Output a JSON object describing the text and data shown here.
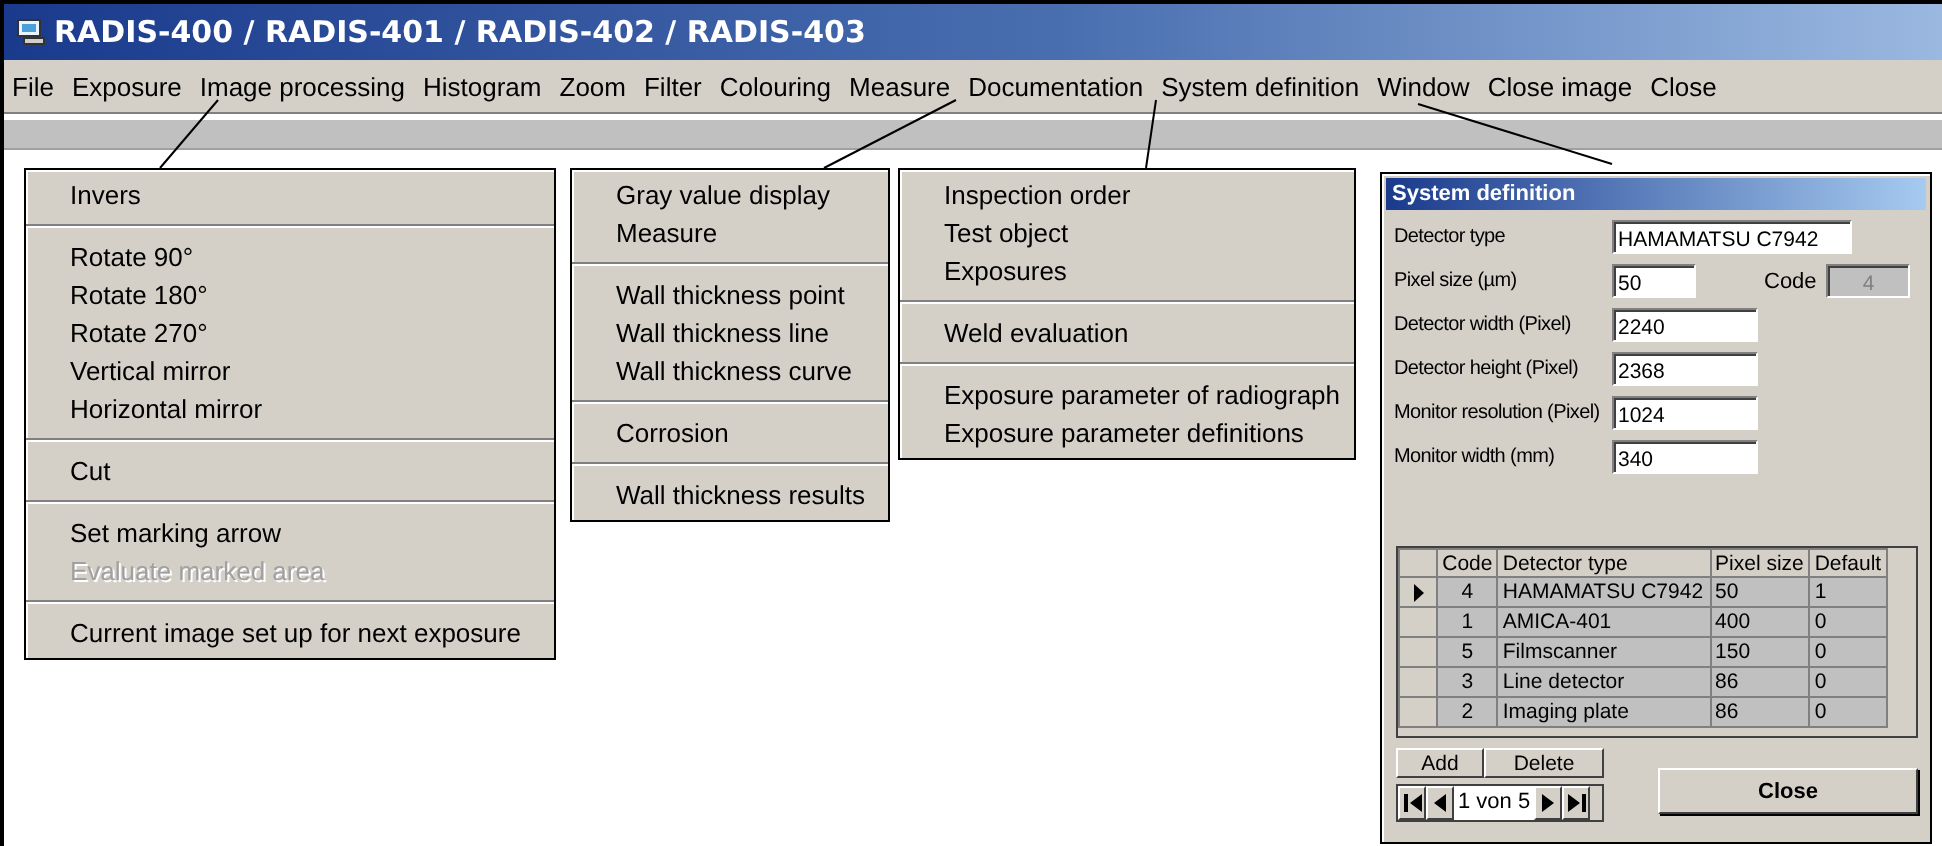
{
  "window": {
    "title": "RADIS-400 / RADIS-401 / RADIS-402 / RADIS-403"
  },
  "menu_bar": [
    "File",
    "Exposure",
    "Image processing",
    "Histogram",
    "Zoom",
    "Filter",
    "Colouring",
    "Measure",
    "Documentation",
    "System definition",
    "Window",
    "Close image",
    "Close"
  ],
  "menus": [
    {
      "items": [
        {
          "kind": "item",
          "label": "Invers",
          "disabled": false
        },
        {
          "kind": "separator"
        },
        {
          "kind": "item",
          "label": "Rotate 90°",
          "disabled": false
        },
        {
          "kind": "item",
          "label": "Rotate 180°",
          "disabled": false
        },
        {
          "kind": "item",
          "label": "Rotate 270°",
          "disabled": false
        },
        {
          "kind": "item",
          "label": "Vertical mirror",
          "disabled": false
        },
        {
          "kind": "item",
          "label": "Horizontal mirror",
          "disabled": false
        },
        {
          "kind": "separator"
        },
        {
          "kind": "item",
          "label": "Cut",
          "disabled": false
        },
        {
          "kind": "separator"
        },
        {
          "kind": "item",
          "label": "Set marking arrow",
          "disabled": false
        },
        {
          "kind": "item",
          "label": "Evaluate marked area",
          "disabled": true
        },
        {
          "kind": "separator"
        },
        {
          "kind": "item",
          "label": "Current image set up for next exposure",
          "disabled": false
        }
      ]
    },
    {
      "items": [
        {
          "kind": "item",
          "label": "Gray value display",
          "disabled": false
        },
        {
          "kind": "item",
          "label": "Measure",
          "disabled": false
        },
        {
          "kind": "separator"
        },
        {
          "kind": "item",
          "label": "Wall thickness point",
          "disabled": false
        },
        {
          "kind": "item",
          "label": "Wall thickness line",
          "disabled": false
        },
        {
          "kind": "item",
          "label": "Wall thickness curve",
          "disabled": false
        },
        {
          "kind": "separator"
        },
        {
          "kind": "item",
          "label": "Corrosion",
          "disabled": false
        },
        {
          "kind": "separator"
        },
        {
          "kind": "item",
          "label": "Wall thickness results",
          "disabled": false
        }
      ]
    },
    {
      "items": [
        {
          "kind": "item",
          "label": "Inspection order",
          "disabled": false
        },
        {
          "kind": "item",
          "label": "Test object",
          "disabled": false
        },
        {
          "kind": "item",
          "label": "Exposures",
          "disabled": false
        },
        {
          "kind": "separator"
        },
        {
          "kind": "item",
          "label": "Weld evaluation",
          "disabled": false
        },
        {
          "kind": "separator"
        },
        {
          "kind": "item",
          "label": "Exposure parameter of radiograph",
          "disabled": false
        },
        {
          "kind": "item",
          "label": "Exposure parameter definitions",
          "disabled": false
        }
      ]
    }
  ],
  "dialog": {
    "title": "System definition",
    "fields": [
      {
        "label": "Detector type",
        "value": "HAMAMATSU C7942"
      },
      {
        "label": "Pixel size (µm)",
        "value": "50",
        "code_label": "Code",
        "code_value": "4"
      },
      {
        "label": "Detector width (Pixel)",
        "value": "2240"
      },
      {
        "label": "Detector height (Pixel)",
        "value": "2368"
      },
      {
        "label": "Monitor resolution (Pixel)",
        "value": "1024"
      },
      {
        "label": "Monitor width (mm)",
        "value": "340"
      }
    ],
    "table": {
      "columns": [
        "Code",
        "Detector type",
        "Pixel size",
        "Default"
      ],
      "rows": [
        {
          "selected": true,
          "cells": [
            "4",
            "HAMAMATSU C7942",
            "50",
            "1"
          ]
        },
        {
          "selected": false,
          "cells": [
            "1",
            "AMICA-401",
            "400",
            "0"
          ]
        },
        {
          "selected": false,
          "cells": [
            "5",
            "Filmscanner",
            "150",
            "0"
          ]
        },
        {
          "selected": false,
          "cells": [
            "3",
            "Line detector",
            "86",
            "0"
          ]
        },
        {
          "selected": false,
          "cells": [
            "2",
            "Imaging plate",
            "86",
            "0"
          ]
        }
      ]
    },
    "buttons": [
      "Add",
      "Delete"
    ],
    "navigator": "1 von 5",
    "close_button": "**C**lose"
  }
}
